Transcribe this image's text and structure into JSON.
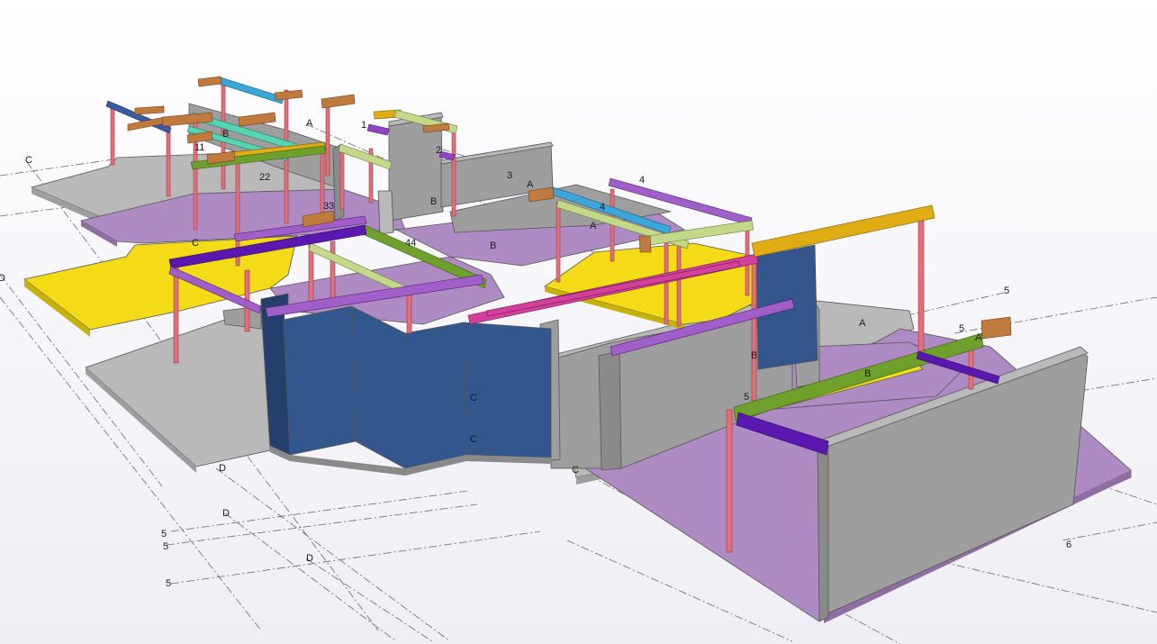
{
  "colors": {
    "background": "#f7f7fb",
    "concrete": "#b9b9b9",
    "shear_wall": "#33568d",
    "slab_purple": "#ae8cc3",
    "slab_yellow": "#f3dc17",
    "column": "#e2707a",
    "beam_purple": "#8e44c4",
    "beam_green": "#6fa02c",
    "beam_gold": "#e0ac14",
    "beam_cyan": "#3ba6d8",
    "beam_teal": "#56d4b4",
    "beam_lime": "#c4d88a",
    "beam_magenta": "#d2409c",
    "beam_indigo": "#5a18b0",
    "beam_navy": "#3b5aa0",
    "bracket_brown": "#c07a3e"
  },
  "grid_labels": {
    "c_far_left": "C",
    "d_far_left": "D",
    "a_top": "A",
    "one_top": "1",
    "b_upper": "B",
    "eleven": "11",
    "two": "2",
    "twentytwo": "22",
    "three": "3",
    "a_mid": "A",
    "four_top": "4",
    "b_core": "B",
    "thirtythree": "33",
    "four_mid": "4",
    "a_mid2": "A",
    "c_left_slab": "C",
    "fortyfour": "44",
    "b_center": "B",
    "five_right": "5",
    "a_right": "A",
    "five_right2": "5",
    "a_far_right": "A",
    "b_right_col": "B",
    "b_right_slab": "B",
    "five_beam": "5",
    "c_wall1": "C",
    "c_wall2": "C",
    "c_bottom": "C",
    "d_bottom1": "D",
    "d_bottom2": "D",
    "d_bottom3": "D",
    "five_left1": "5",
    "five_left2": "5",
    "five_left3": "5",
    "six": "6"
  }
}
